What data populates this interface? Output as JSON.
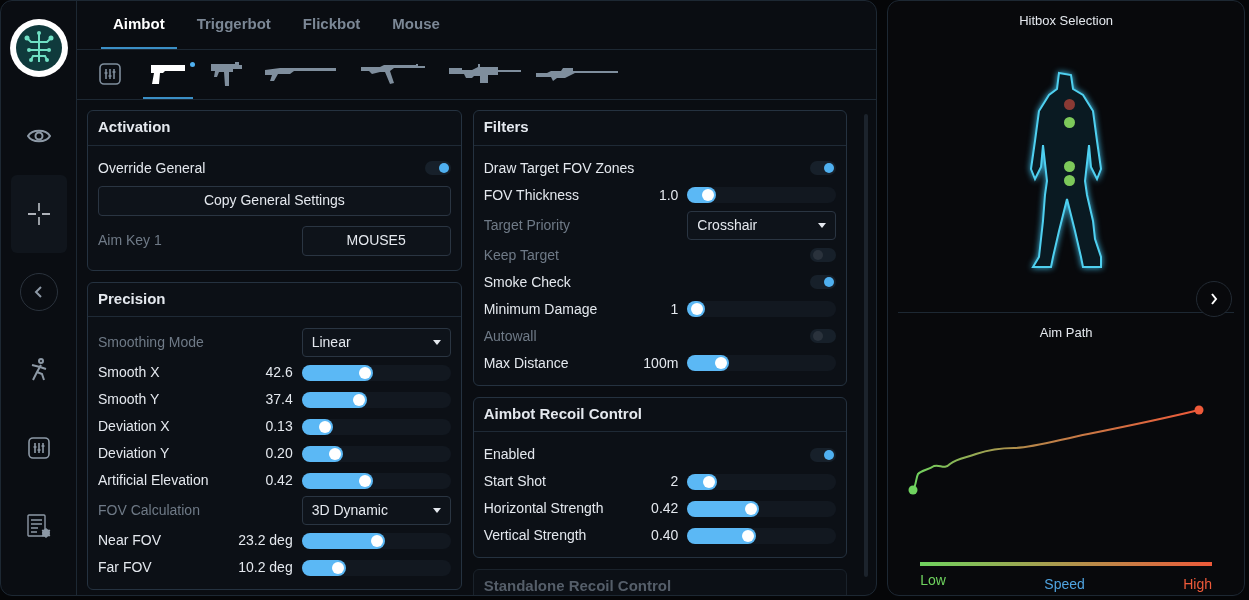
{
  "sidebar": {
    "items": [
      {
        "kind": "eye",
        "selected": false
      },
      {
        "kind": "crosshair",
        "selected": true
      },
      {
        "kind": "radar",
        "selected": false
      },
      {
        "kind": "runner",
        "selected": false
      },
      {
        "kind": "sliders",
        "selected": false
      },
      {
        "kind": "list-bug",
        "selected": false
      }
    ]
  },
  "tabs": [
    {
      "label": "Aimbot",
      "selected": true
    },
    {
      "label": "Triggerbot",
      "selected": false
    },
    {
      "label": "Flickbot",
      "selected": false
    },
    {
      "label": "Mouse",
      "selected": false
    }
  ],
  "weapons": [
    {
      "kind": "sliders",
      "selected": false,
      "modified": false
    },
    {
      "kind": "pistol",
      "selected": true,
      "modified": true
    },
    {
      "kind": "smg",
      "selected": false,
      "modified": false
    },
    {
      "kind": "shotgun",
      "selected": false,
      "modified": false
    },
    {
      "kind": "rifle",
      "selected": false,
      "modified": false
    },
    {
      "kind": "machine-gun",
      "selected": false,
      "modified": false
    },
    {
      "kind": "sniper",
      "selected": false,
      "modified": false
    }
  ],
  "columns": [
    [
      {
        "title": "Activation",
        "dimmed": false,
        "rows": [
          {
            "kind": "toggle",
            "label": "Override General",
            "on": true,
            "disabled": false
          },
          {
            "kind": "button",
            "label": "Copy General Settings"
          },
          {
            "kind": "keybind",
            "label": "Aim Key 1",
            "value": "MOUSE5",
            "disabled": true
          }
        ]
      },
      {
        "title": "Precision",
        "dimmed": false,
        "rows": [
          {
            "kind": "select",
            "label": "Smoothing Mode",
            "value": "Linear",
            "disabled": true
          },
          {
            "kind": "slider",
            "label": "Smooth X",
            "reading": "42.6",
            "level": 0.48
          },
          {
            "kind": "slider",
            "label": "Smooth Y",
            "reading": "37.4",
            "level": 0.44
          },
          {
            "kind": "slider",
            "label": "Deviation X",
            "reading": "0.13",
            "level": 0.21
          },
          {
            "kind": "slider",
            "label": "Deviation Y",
            "reading": "0.20",
            "level": 0.28
          },
          {
            "kind": "slider",
            "label": "Artificial Elevation",
            "reading": "0.42",
            "level": 0.48
          },
          {
            "kind": "select",
            "label": "FOV Calculation",
            "value": "3D Dynamic",
            "disabled": true
          },
          {
            "kind": "slider",
            "label": "Near FOV",
            "reading": "23.2 deg",
            "level": 0.56
          },
          {
            "kind": "slider",
            "label": "Far FOV",
            "reading": "10.2 deg",
            "level": 0.3
          }
        ]
      }
    ],
    [
      {
        "title": "Filters",
        "dimmed": false,
        "rows": [
          {
            "kind": "toggle",
            "label": "Draw Target FOV Zones",
            "on": true,
            "disabled": false
          },
          {
            "kind": "slider",
            "label": "FOV Thickness",
            "reading": "1.0",
            "level": 0.19
          },
          {
            "kind": "select",
            "label": "Target Priority",
            "value": "Crosshair",
            "disabled": true
          },
          {
            "kind": "toggle",
            "label": "Keep Target",
            "on": false,
            "disabled": true
          },
          {
            "kind": "toggle",
            "label": "Smoke Check",
            "on": true,
            "disabled": false
          },
          {
            "kind": "slider",
            "label": "Minimum Damage",
            "reading": "1",
            "level": 0.12
          },
          {
            "kind": "toggle",
            "label": "Autowall",
            "on": false,
            "disabled": true
          },
          {
            "kind": "slider",
            "label": "Max Distance",
            "reading": "100m",
            "level": 0.28
          }
        ]
      },
      {
        "title": "Aimbot Recoil Control",
        "dimmed": false,
        "rows": [
          {
            "kind": "toggle",
            "label": "Enabled",
            "on": true,
            "disabled": false
          },
          {
            "kind": "slider",
            "label": "Start Shot",
            "reading": "2",
            "level": 0.2
          },
          {
            "kind": "slider",
            "label": "Horizontal Strength",
            "reading": "0.42",
            "level": 0.48
          },
          {
            "kind": "slider",
            "label": "Vertical Strength",
            "reading": "0.40",
            "level": 0.46
          }
        ]
      },
      {
        "title": "Standalone Recoil Control",
        "dimmed": true
      }
    ]
  ],
  "hitbox": {
    "title": "Hitbox Selection",
    "points": [
      {
        "color": "#8a3a34"
      },
      {
        "color": "#7dc95a"
      },
      {
        "color": "#7dc95a"
      },
      {
        "color": "#7dc95a"
      }
    ]
  },
  "aim_path": {
    "title": "Aim Path",
    "low": "Low",
    "axis": "Speed",
    "high": "High"
  }
}
